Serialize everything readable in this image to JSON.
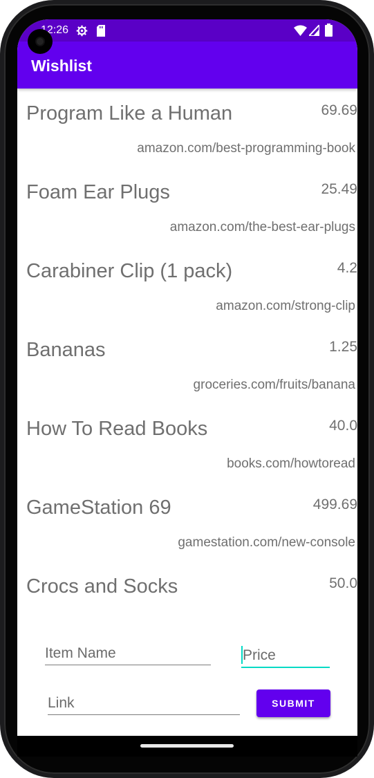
{
  "status": {
    "time": "12:26"
  },
  "app": {
    "title": "Wishlist"
  },
  "items": [
    {
      "name": "Program Like a Human",
      "price": "69.69",
      "link": "amazon.com/best-programming-book"
    },
    {
      "name": "Foam Ear Plugs",
      "price": "25.49",
      "link": "amazon.com/the-best-ear-plugs"
    },
    {
      "name": "Carabiner Clip (1 pack)",
      "price": "4.2",
      "link": "amazon.com/strong-clip"
    },
    {
      "name": "Bananas",
      "price": "1.25",
      "link": "groceries.com/fruits/banana"
    },
    {
      "name": "How To Read Books",
      "price": "40.0",
      "link": "books.com/howtoread"
    },
    {
      "name": "GameStation 69",
      "price": "499.69",
      "link": "gamestation.com/new-console"
    },
    {
      "name": "Crocs and Socks",
      "price": "50.0",
      "link": ""
    }
  ],
  "form": {
    "item_name_placeholder": "Item Name",
    "price_placeholder": "Price",
    "link_placeholder": "Link",
    "submit_label": "SUBMIT"
  },
  "colors": {
    "appbar": "#6200ee",
    "statusbar": "#5a00c6",
    "accent": "#03dac5"
  },
  "icons": [
    "settings-icon",
    "sd-card-icon",
    "wifi-icon",
    "signal-icon",
    "battery-icon"
  ]
}
